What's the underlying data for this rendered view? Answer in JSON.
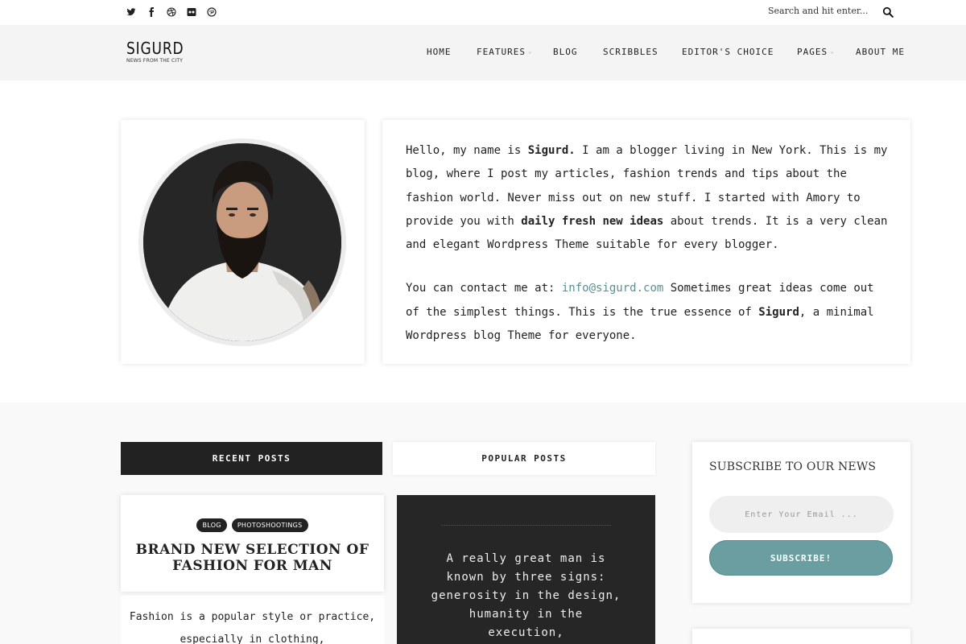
{
  "topbar": {
    "social": [
      {
        "icon": "twitter-icon",
        "glyph": "🐦"
      },
      {
        "icon": "facebook-icon",
        "glyph": "f"
      },
      {
        "icon": "dribbble-icon",
        "glyph": "⚽"
      },
      {
        "icon": "flickr-icon",
        "glyph": "●●"
      },
      {
        "icon": "pinterest-icon",
        "glyph": "P"
      }
    ],
    "search_placeholder": "Search and hit enter..."
  },
  "header": {
    "logo_name": "SIGURD",
    "logo_tagline": "NEWS FROM THE CITY",
    "nav": [
      {
        "label": "HOME",
        "has_dropdown": false
      },
      {
        "label": "FEATURES",
        "has_dropdown": true
      },
      {
        "label": "BLOG",
        "has_dropdown": false
      },
      {
        "label": "SCRIBBLES",
        "has_dropdown": false
      },
      {
        "label": "EDITOR'S CHOICE",
        "has_dropdown": false
      },
      {
        "label": "PAGES",
        "has_dropdown": true
      },
      {
        "label": "ABOUT ME",
        "has_dropdown": false
      }
    ]
  },
  "about": {
    "p1_a": "Hello, my name is ",
    "p1_b": "Sigurd.",
    "p1_c": " I am a blogger living in New York. This is my blog, where I post my articles, fashion trends and tips about the fashion world. Never miss out on new stuff. I started with Amory to provide you with ",
    "p1_d": "daily fresh new ideas",
    "p1_e": " about trends. It is a very clean and elegant Wordpress Theme suitable for every blogger.",
    "p2_a": "You can contact me at: ",
    "p2_email": "info@sigurd.com",
    "p2_b": " Sometimes great ideas come out of the simplest things. This is the true essence of ",
    "p2_c": "Sigurd",
    "p2_d": ", a minimal Wordpress blog Theme for everyone."
  },
  "tabs": {
    "recent": "RECENT POSTS",
    "popular": "POPULAR POSTS"
  },
  "post": {
    "badges": [
      "BLOG",
      "PHOTOSHOOTINGS"
    ],
    "title": "BRAND NEW SELECTION OF FASHION FOR MAN",
    "excerpt": "Fashion is a popular style or practice, especially in clothing,"
  },
  "quote": {
    "text": "A really great man is known by three signs: generosity in the design, humanity in the execution,"
  },
  "subscribe": {
    "title": "SUBSCRIBE TO OUR NEWS",
    "placeholder": "Enter Your Email ...",
    "button": "SUBSCRIBE!"
  },
  "colors": {
    "accent": "#6a9ea0",
    "link": "#5a8f94",
    "dark": "#222222"
  }
}
